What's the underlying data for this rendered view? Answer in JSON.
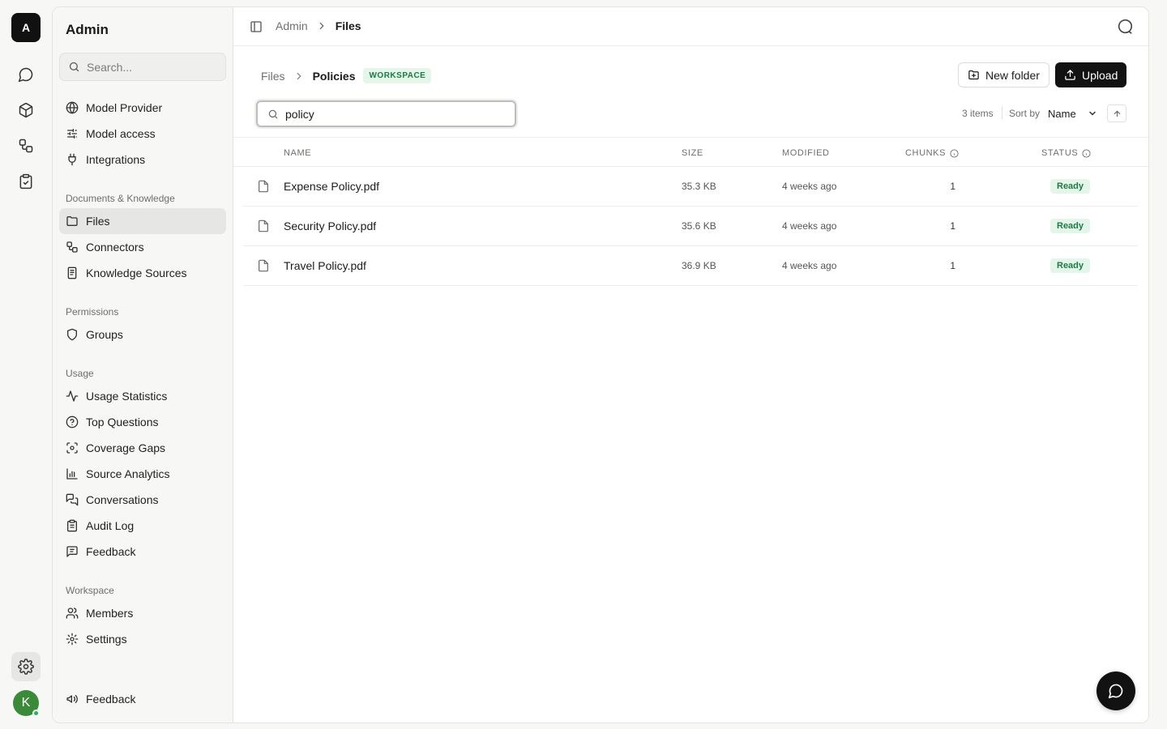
{
  "rail": {
    "logo": "A",
    "icons": [
      "chat-icon",
      "cube-icon",
      "workflow-icon",
      "clipboard-check-icon"
    ],
    "settings_icon": "gear-icon",
    "avatar_initial": "K",
    "online_color": "#22b35e"
  },
  "sidebar": {
    "title": "Admin",
    "search_placeholder": "Search...",
    "items_top": [
      {
        "label": "Model Provider",
        "icon": "globe-icon"
      },
      {
        "label": "Model access",
        "icon": "sliders-icon"
      },
      {
        "label": "Integrations",
        "icon": "plug-icon"
      }
    ],
    "sections": [
      {
        "title": "Documents & Knowledge",
        "items": [
          {
            "label": "Files",
            "icon": "folder-icon",
            "active": true
          },
          {
            "label": "Connectors",
            "icon": "workflow-icon"
          },
          {
            "label": "Knowledge Sources",
            "icon": "book-icon"
          }
        ]
      },
      {
        "title": "Permissions",
        "items": [
          {
            "label": "Groups",
            "icon": "shield-icon"
          }
        ]
      },
      {
        "title": "Usage",
        "items": [
          {
            "label": "Usage Statistics",
            "icon": "activity-icon"
          },
          {
            "label": "Top Questions",
            "icon": "help-circle-icon"
          },
          {
            "label": "Coverage Gaps",
            "icon": "scan-icon"
          },
          {
            "label": "Source Analytics",
            "icon": "bar-chart-icon"
          },
          {
            "label": "Conversations",
            "icon": "messages-icon"
          },
          {
            "label": "Audit Log",
            "icon": "clipboard-list-icon"
          },
          {
            "label": "Feedback",
            "icon": "message-square-icon"
          }
        ]
      },
      {
        "title": "Workspace",
        "items": [
          {
            "label": "Members",
            "icon": "users-icon"
          },
          {
            "label": "Settings",
            "icon": "gear-icon"
          }
        ]
      }
    ],
    "footer_item": {
      "label": "Feedback",
      "icon": "megaphone-icon"
    }
  },
  "topbar": {
    "breadcrumb": [
      "Admin",
      "Files"
    ]
  },
  "content": {
    "breadcrumb": [
      "Files",
      "Policies"
    ],
    "badge": "WORKSPACE",
    "new_folder_label": "New folder",
    "upload_label": "Upload",
    "filter_value": "policy",
    "items_count": "3 items",
    "sort_label": "Sort by",
    "sort_value": "Name",
    "columns": {
      "name": "NAME",
      "size": "SIZE",
      "modified": "MODIFIED",
      "chunks": "CHUNKS",
      "status": "STATUS"
    },
    "rows": [
      {
        "name": "Expense Policy.pdf",
        "size": "35.3 KB",
        "modified": "4 weeks ago",
        "chunks": "1",
        "status": "Ready"
      },
      {
        "name": "Security Policy.pdf",
        "size": "35.6 KB",
        "modified": "4 weeks ago",
        "chunks": "1",
        "status": "Ready"
      },
      {
        "name": "Travel Policy.pdf",
        "size": "36.9 KB",
        "modified": "4 weeks ago",
        "chunks": "1",
        "status": "Ready"
      }
    ]
  },
  "colors": {
    "accent": "#121212",
    "ready_bg": "#e4f5ea",
    "ready_text": "#1e7a45"
  }
}
